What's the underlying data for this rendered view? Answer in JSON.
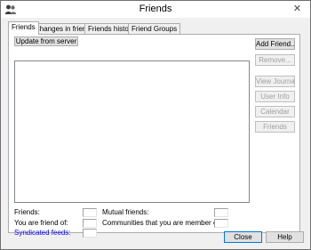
{
  "window": {
    "title": "Friends",
    "close_glyph": "✕",
    "icon": "users-icon"
  },
  "tabs": [
    {
      "label": "Friends",
      "active": true
    },
    {
      "label": "Changes in friends"
    },
    {
      "label": "Friends history"
    },
    {
      "label": "Friend Groups"
    }
  ],
  "friends_tab": {
    "update_button": "Update from server",
    "side_buttons": {
      "add_friend": "Add Friend...",
      "remove": "Remove...",
      "view_journal": "View Journal",
      "user_info": "User Info",
      "calendar": "Calendar",
      "friends": "Friends"
    },
    "stats": {
      "friends": "Friends:",
      "you_are_friend_of": "You are friend of:",
      "syndicated_feeds": "Syndicated feeds:",
      "mutual_friends": "Mutual friends:",
      "communities": "Communities that you are member of:"
    }
  },
  "footer": {
    "close": "Close",
    "help": "Help"
  },
  "colors": {
    "link": "#0000ff",
    "disabled": "#a0a0a0"
  }
}
